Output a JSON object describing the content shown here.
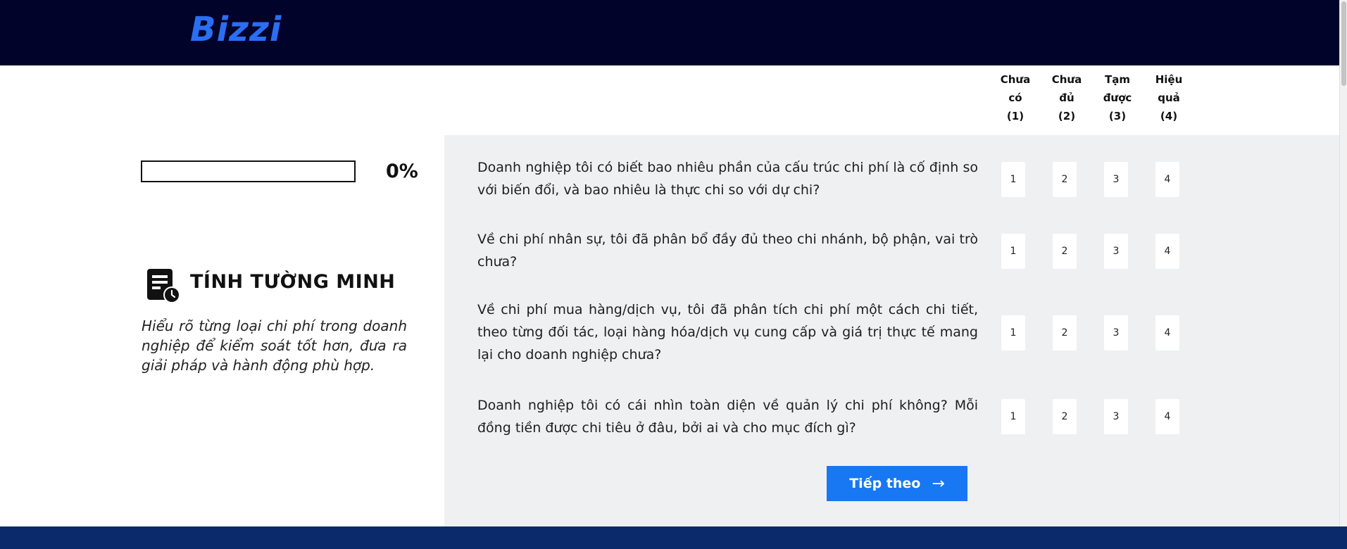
{
  "brand": {
    "logo_text": "Bizzi",
    "accent": "#1877f2",
    "header_bg": "#02032b"
  },
  "rating_scale": {
    "headers": [
      {
        "line1": "Chưa",
        "line2": "có",
        "line3": "(1)"
      },
      {
        "line1": "Chưa",
        "line2": "đủ",
        "line3": "(2)"
      },
      {
        "line1": "Tạm",
        "line2": "được",
        "line3": "(3)"
      },
      {
        "line1": "Hiệu",
        "line2": "quả",
        "line3": "(4)"
      }
    ]
  },
  "progress": {
    "percent_label": "0%",
    "value": 0
  },
  "section": {
    "icon": "document-clock-icon",
    "title": "TÍNH TƯỜNG MINH",
    "description": "Hiểu rõ từng loại chi phí trong doanh nghiệp để kiểm soát tốt hơn, đưa ra giải pháp và hành động phù hợp."
  },
  "questions": [
    {
      "text": "Doanh nghiệp tôi có biết bao nhiêu phần của cấu trúc chi phí là cố định so với biến đổi, và bao nhiêu là thực chi so với dự chi?",
      "options": [
        "1",
        "2",
        "3",
        "4"
      ]
    },
    {
      "text": "Về chi phí nhân sự, tôi đã phân bổ đầy đủ theo chi nhánh, bộ phận, vai trò chưa?",
      "options": [
        "1",
        "2",
        "3",
        "4"
      ]
    },
    {
      "text": "Về chi phí mua hàng/dịch vụ, tôi đã phân tích chi phí một cách chi tiết, theo từng đối tác, loại hàng hóa/dịch vụ cung cấp và giá trị thực tế mang lại cho doanh nghiệp chưa?",
      "options": [
        "1",
        "2",
        "3",
        "4"
      ]
    },
    {
      "text": "Doanh nghiệp tôi có cái nhìn toàn diện về quản lý chi phí không? Mỗi đồng tiền được chi tiêu ở đâu, bởi ai và cho mục đích gì?",
      "options": [
        "1",
        "2",
        "3",
        "4"
      ]
    }
  ],
  "next_button": {
    "label": "Tiếp theo",
    "arrow": "→"
  }
}
